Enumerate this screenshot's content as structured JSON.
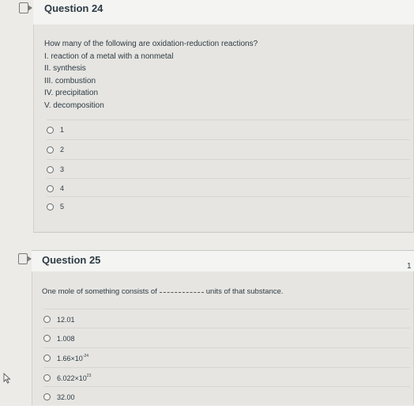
{
  "q24": {
    "title": "Question 24",
    "prompt": "How many of the following are oxidation-reduction reactions?",
    "items": [
      "I. reaction of a metal with a nonmetal",
      "II. synthesis",
      "III. combustion",
      "IV. precipitation",
      "V. decomposition"
    ],
    "answers": [
      "1",
      "2",
      "3",
      "4",
      "5"
    ]
  },
  "q25": {
    "title": "Question 25",
    "prompt_before": "One mole of something consists of",
    "prompt_after": "units of that substance.",
    "answers": [
      {
        "mantissa": "12.01",
        "exponent": ""
      },
      {
        "mantissa": "1.008",
        "exponent": ""
      },
      {
        "mantissa": "1.66×10",
        "exponent": "-24"
      },
      {
        "mantissa": "6.022×10",
        "exponent": "23"
      },
      {
        "mantissa": "32.00",
        "exponent": ""
      }
    ]
  },
  "side_number": "1",
  "icons": {
    "flag": "flag-icon",
    "cursor": "cursor-icon"
  }
}
